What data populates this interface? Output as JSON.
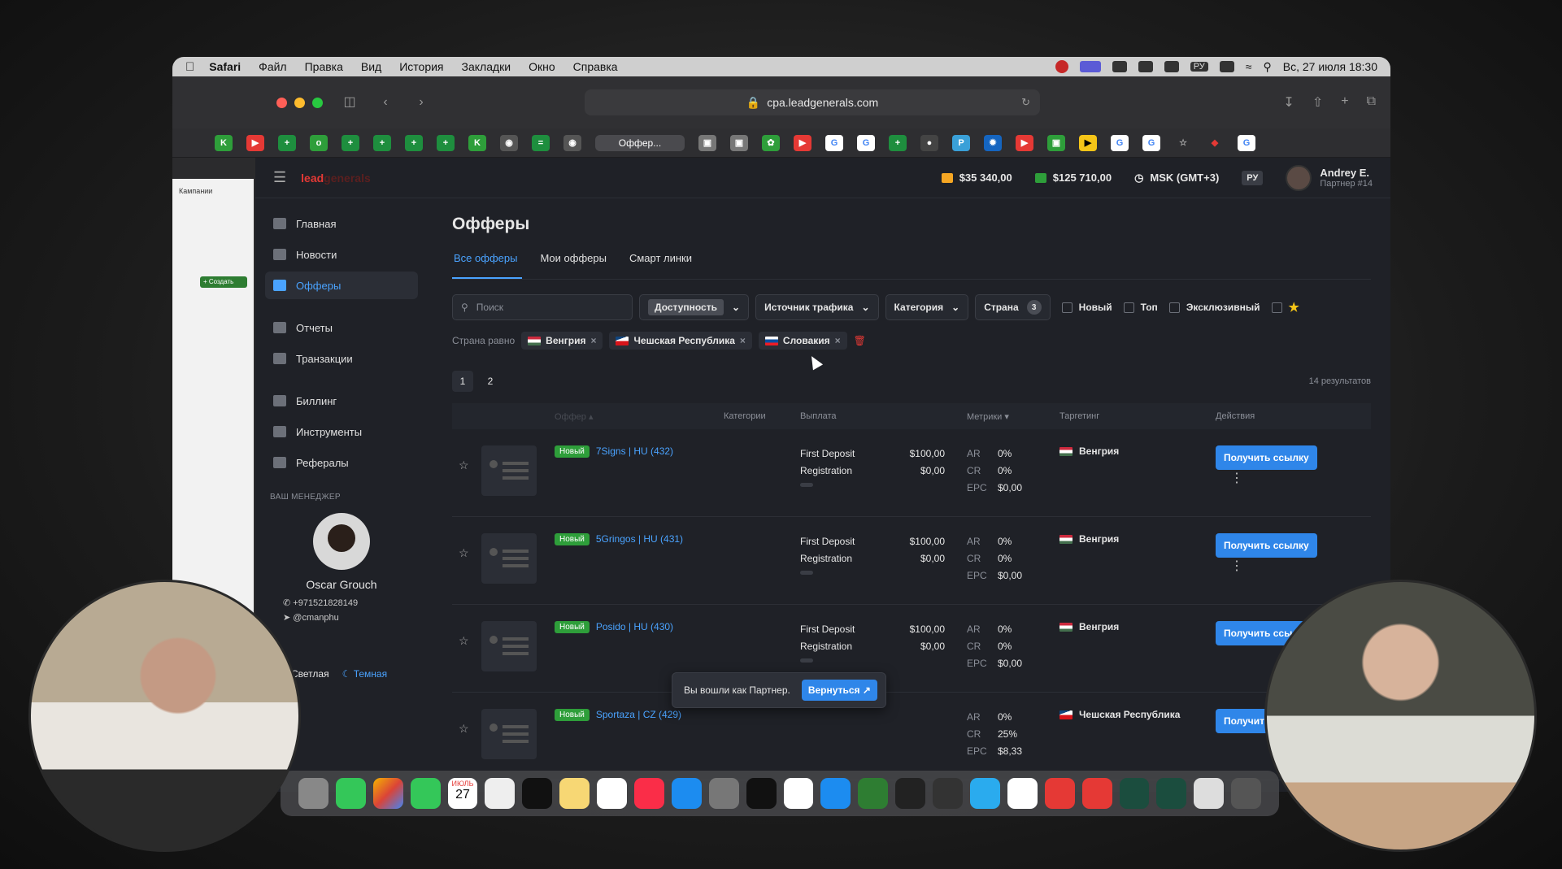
{
  "menubar": {
    "app": "Safari",
    "items": [
      "Файл",
      "Правка",
      "Вид",
      "История",
      "Закладки",
      "Окно",
      "Справка"
    ],
    "input_source": "РУ",
    "datetime": "Вс, 27 июля  18:30"
  },
  "browser": {
    "url": "cpa.leadgenerals.com",
    "active_tab": "Оффер..."
  },
  "ghost_window": {
    "label": "Кампании",
    "create_label": "+ Создать"
  },
  "header": {
    "balance1": "$35 340,00",
    "balance2": "$125 710,00",
    "timezone": "MSK (GMT+3)",
    "lang": "РУ",
    "user_name": "Andrey E.",
    "user_role": "Партнер #14"
  },
  "sidebar": {
    "items": [
      {
        "label": "Главная"
      },
      {
        "label": "Новости"
      },
      {
        "label": "Офферы"
      },
      {
        "label": "Отчеты"
      },
      {
        "label": "Транзакции"
      },
      {
        "label": "Биллинг"
      },
      {
        "label": "Инструменты"
      },
      {
        "label": "Рефералы"
      }
    ],
    "manager_title": "ВАШ МЕНЕДЖЕР",
    "manager_name": "Oscar Grouch",
    "manager_phone": "+971521828149",
    "manager_handle": "@cmanphu",
    "theme_light": "Светлая",
    "theme_dark": "Темная"
  },
  "main": {
    "title": "Офферы",
    "tabs": [
      {
        "label": "Все офферы"
      },
      {
        "label": "Мои офферы"
      },
      {
        "label": "Смарт линки"
      }
    ],
    "search_placeholder": "Поиск",
    "filter_availability": "Доступность",
    "filter_source": "Источник трафика",
    "filter_category": "Категория",
    "filter_country": "Страна",
    "filter_country_count": "3",
    "check_new": "Новый",
    "check_top": "Топ",
    "check_exclusive": "Эксклюзивный",
    "chips_label": "Страна равно",
    "chips": [
      {
        "label": "Венгрия",
        "flag": "hu"
      },
      {
        "label": "Чешская Республика",
        "flag": "cz"
      },
      {
        "label": "Словакия",
        "flag": "sk"
      }
    ],
    "pages": [
      "1",
      "2"
    ],
    "results": "14  результатов",
    "columns": {
      "offer": "Оффер ▴",
      "category": "Категории",
      "payout": "Выплата",
      "metrics": "Метрики ▾",
      "targeting": "Таргетинг",
      "actions": "Действия"
    },
    "rows": [
      {
        "badge": "Новый",
        "name": "7Signs | HU (432)",
        "pay1_label": "First Deposit",
        "pay1_value": "$100,00",
        "pay2_label": "Registration",
        "pay2_value": "$0,00",
        "ar": "0%",
        "cr": "0%",
        "epc": "$0,00",
        "country": "Венгрия",
        "flag": "hu",
        "action": "Получить ссылку"
      },
      {
        "badge": "Новый",
        "name": "5Gringos | HU (431)",
        "pay1_label": "First Deposit",
        "pay1_value": "$100,00",
        "pay2_label": "Registration",
        "pay2_value": "$0,00",
        "ar": "0%",
        "cr": "0%",
        "epc": "$0,00",
        "country": "Венгрия",
        "flag": "hu",
        "action": "Получить ссылку"
      },
      {
        "badge": "Новый",
        "name": "Posido | HU (430)",
        "pay1_label": "First Deposit",
        "pay1_value": "$100,00",
        "pay2_label": "Registration",
        "pay2_value": "$0,00",
        "ar": "0%",
        "cr": "0%",
        "epc": "$0,00",
        "country": "Венгрия",
        "flag": "hu",
        "action": "Получить ссылку"
      },
      {
        "badge": "Новый",
        "name": "Sportaza | CZ (429)",
        "pay1_label": "",
        "pay1_value": "",
        "pay2_label": "",
        "pay2_value": "",
        "ar": "0%",
        "cr": "25%",
        "epc": "$8,33",
        "country": "Чешская Республика",
        "flag": "cz",
        "action": "Получить"
      }
    ],
    "metric_labels": {
      "ar": "AR",
      "cr": "CR",
      "epc": "EPC"
    }
  },
  "toast": {
    "text": "Вы вошли как Партнер.",
    "button": "Вернуться ↗"
  },
  "dock": {
    "calendar_month": "ИЮЛЬ",
    "calendar_day": "27"
  },
  "colors": {
    "accent": "#4aa3ff",
    "button": "#2f86e9",
    "new_badge": "#2e9e3a",
    "bg": "#1f2127"
  }
}
